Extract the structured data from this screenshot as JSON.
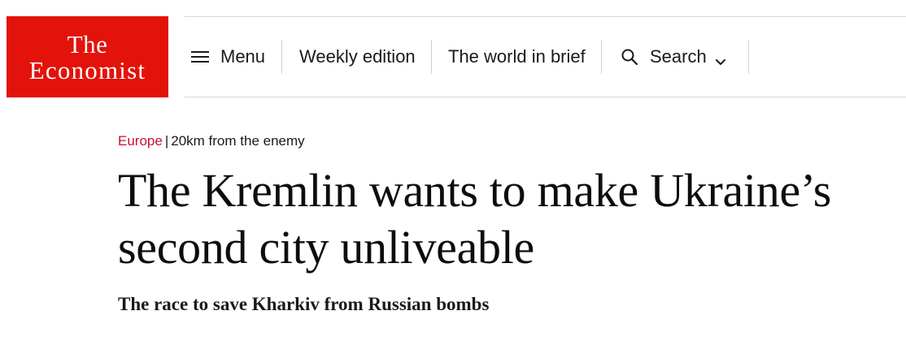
{
  "brand": {
    "logo_line1": "The",
    "logo_line2": "Economist",
    "color": "#e3120b"
  },
  "nav": {
    "menu_label": "Menu",
    "menu_icon": "hamburger-icon",
    "weekly_edition_label": "Weekly edition",
    "world_in_brief_label": "The world in brief",
    "search_label": "Search",
    "search_icon": "magnifier-icon",
    "search_chevron_icon": "chevron-down-icon"
  },
  "article": {
    "section": "Europe",
    "separator": "|",
    "fly_title": "20km from the enemy",
    "headline": "The Kremlin wants to make Ukraine’s second city unliveable",
    "subheadline": "The race to save Kharkiv from Russian bombs",
    "section_color": "#c8102e"
  }
}
